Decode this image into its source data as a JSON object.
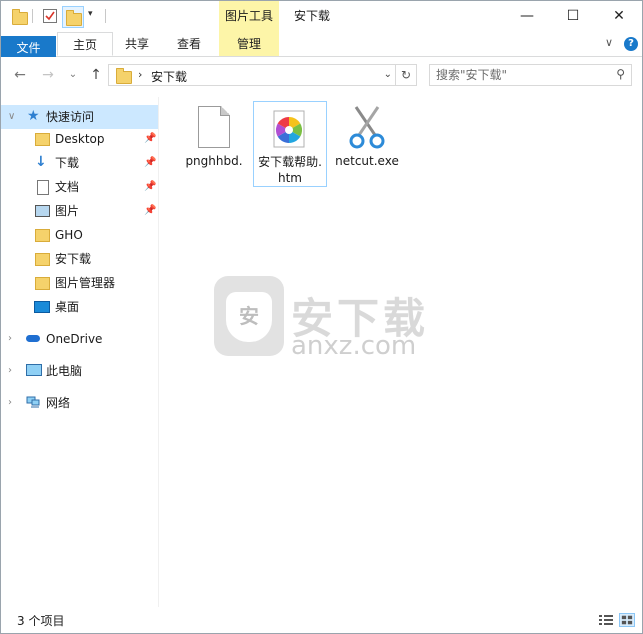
{
  "window": {
    "title": "安下载",
    "contextual_tab_header": "图片工具",
    "buttons": {
      "minimize": "—",
      "maximize": "☐",
      "close": "✕"
    }
  },
  "ribbon": {
    "tabs": [
      "文件",
      "主页",
      "共享",
      "查看",
      "管理"
    ],
    "collapse_icon": "chevron-down",
    "help_glyph": "?"
  },
  "address": {
    "current": "安下载",
    "search_placeholder": "搜索\"安下载\""
  },
  "sidebar": {
    "quick_access": "快速访问",
    "items": [
      {
        "label": "Desktop",
        "icon": "folder",
        "pinned": true
      },
      {
        "label": "下载",
        "icon": "download-arrow",
        "pinned": true
      },
      {
        "label": "文档",
        "icon": "document",
        "pinned": true
      },
      {
        "label": "图片",
        "icon": "picture",
        "pinned": true
      },
      {
        "label": "GHO",
        "icon": "folder",
        "pinned": false
      },
      {
        "label": "安下载",
        "icon": "folder",
        "pinned": false
      },
      {
        "label": "图片管理器",
        "icon": "folder",
        "pinned": false
      },
      {
        "label": "桌面",
        "icon": "desktop",
        "pinned": false
      }
    ],
    "onedrive": "OneDrive",
    "this_pc": "此电脑",
    "network": "网络"
  },
  "files": [
    {
      "name": "pnghhbd.",
      "icon": "blank-file",
      "selected": false
    },
    {
      "name": "安下载帮助.htm",
      "icon": "color-pinwheel",
      "selected": true
    },
    {
      "name": "netcut.exe",
      "icon": "scissors",
      "selected": false
    }
  ],
  "watermark": {
    "badge_char": "安",
    "title": "安下载",
    "url": "anxz.com"
  },
  "status": {
    "item_count": "3 个项目"
  }
}
